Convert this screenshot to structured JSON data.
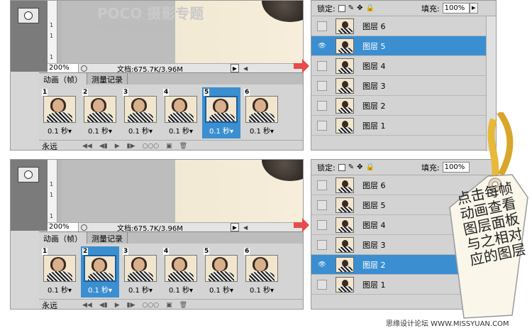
{
  "watermark": {
    "brand": "POCO 摄影专题",
    "url": "http://photo.poco.cn/"
  },
  "top": {
    "zoom": "200%",
    "docinfo": "文档:675.7K/3.96M",
    "tabs": [
      "动画（帧）",
      "测量记录"
    ],
    "frames": [
      {
        "num": "1",
        "delay": "0.1 秒▾"
      },
      {
        "num": "2",
        "delay": "0.1 秒▾"
      },
      {
        "num": "3",
        "delay": "0.1 秒▾"
      },
      {
        "num": "4",
        "delay": "0.1 秒▾"
      },
      {
        "num": "5",
        "delay": "0.1 秒▾"
      },
      {
        "num": "6",
        "delay": "0.1 秒▾"
      }
    ],
    "selected_frame": 5,
    "loop": "永远",
    "lock_label": "锁定:",
    "fill_label": "填充:",
    "fill_value": "100%",
    "layers": [
      "图层 6",
      "图层 5",
      "图层 4",
      "图层 3",
      "图层 2",
      "图层 1"
    ],
    "selected_layer": "图层 5"
  },
  "bottom": {
    "zoom": "200%",
    "docinfo": "文档:675.7K/3.96M",
    "tabs": [
      "动画（帧）",
      "测量记录"
    ],
    "frames": [
      {
        "num": "1",
        "delay": "0.1 秒▾"
      },
      {
        "num": "2",
        "delay": "0.1 秒▾"
      },
      {
        "num": "3",
        "delay": "0.1 秒▾"
      },
      {
        "num": "4",
        "delay": "0.1 秒▾"
      },
      {
        "num": "5",
        "delay": "0.1 秒▾"
      },
      {
        "num": "6",
        "delay": "0.1 秒▾"
      }
    ],
    "selected_frame": 2,
    "loop": "永远",
    "lock_label": "锁定:",
    "fill_label": "填充:",
    "fill_value": "100%",
    "layers": [
      "图层 6",
      "图层 5",
      "图层 4",
      "图层 3",
      "图层 2",
      "图层 1"
    ],
    "selected_layer": "图层 2"
  },
  "tag": {
    "lines": [
      "点击每帧",
      "动画查看",
      "图层面板",
      "与之相对",
      "应的图层"
    ]
  },
  "footer": "思缘设计论坛 WWW.MISSYUAN.COM",
  "colors": {
    "selection": "#3b8fd0",
    "arrow": "#e94b4b",
    "ribbon": "#e8b83a"
  }
}
